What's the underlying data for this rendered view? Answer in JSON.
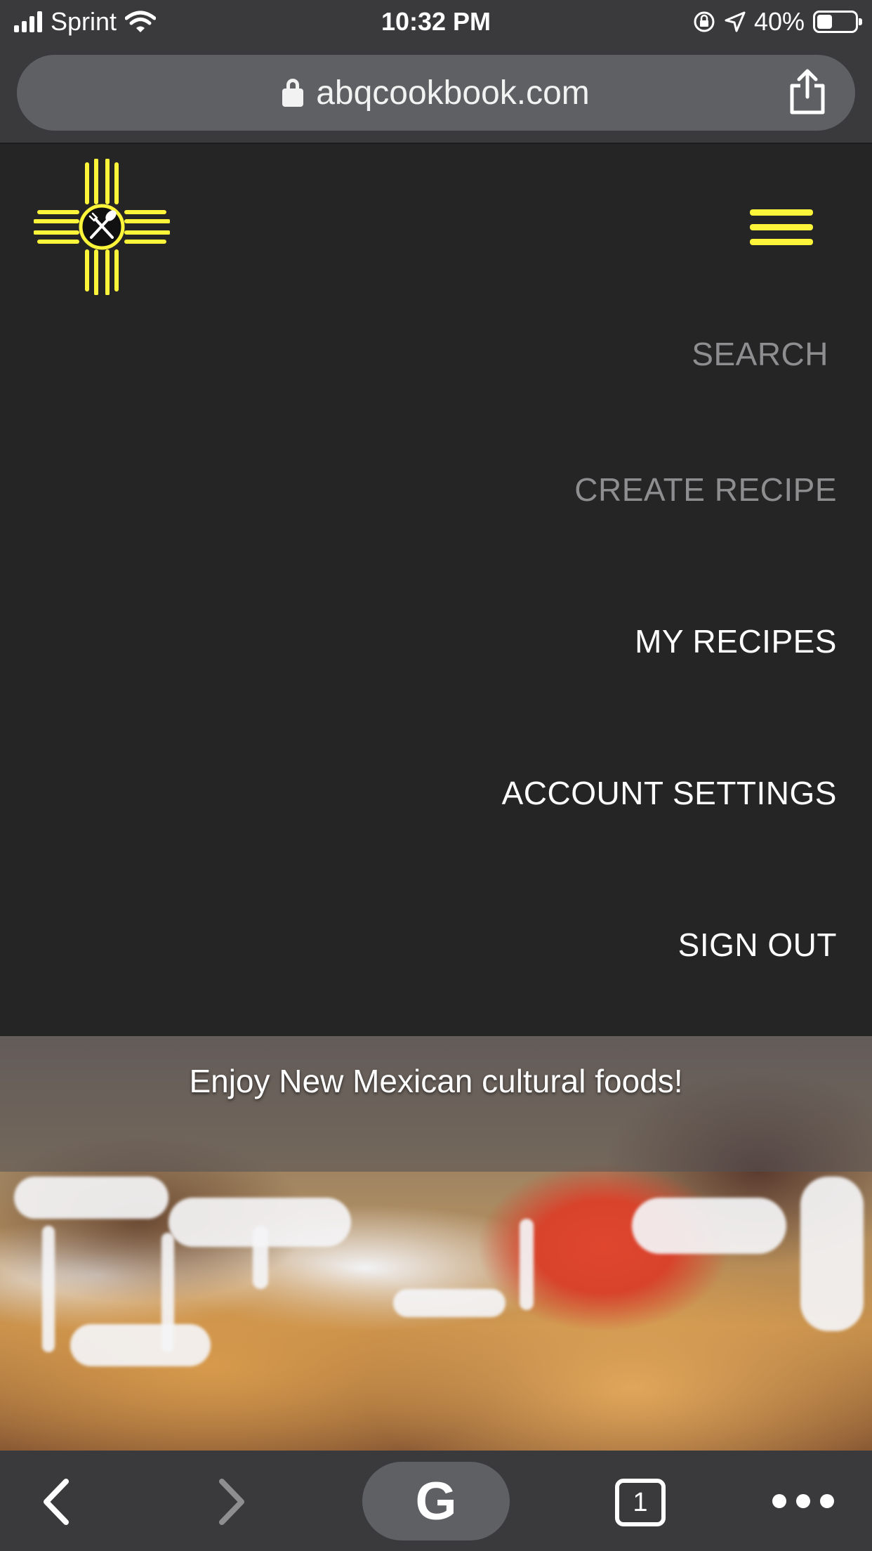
{
  "status_bar": {
    "carrier": "Sprint",
    "time": "10:32 PM",
    "battery_percent": "40%",
    "battery_level": 0.4,
    "icons": [
      "signal-icon",
      "wifi-icon",
      "rotation-lock-icon",
      "location-icon",
      "battery-icon"
    ]
  },
  "browser": {
    "url": "abqcookbook.com",
    "icons": [
      "lock-icon",
      "share-icon"
    ]
  },
  "header": {
    "logo": "zia-sun-fork-spoon-logo",
    "menu_icon": "hamburger-menu-icon",
    "accent_color": "#fcf53a"
  },
  "menu": {
    "items": [
      {
        "label": "SEARCH",
        "state": "dim"
      },
      {
        "label": "CREATE RECIPE",
        "state": "dim"
      },
      {
        "label": "MY RECIPES",
        "state": "bright"
      },
      {
        "label": "ACCOUNT SETTINGS",
        "state": "bright"
      },
      {
        "label": "SIGN OUT",
        "state": "bright"
      }
    ]
  },
  "hero": {
    "tagline": "Enjoy New Mexican cultural foods!"
  },
  "toolbar": {
    "google_label": "G",
    "tab_count": "1",
    "icons": [
      "back-arrow-icon",
      "forward-arrow-icon",
      "google-icon",
      "tabs-icon",
      "more-icon"
    ]
  }
}
